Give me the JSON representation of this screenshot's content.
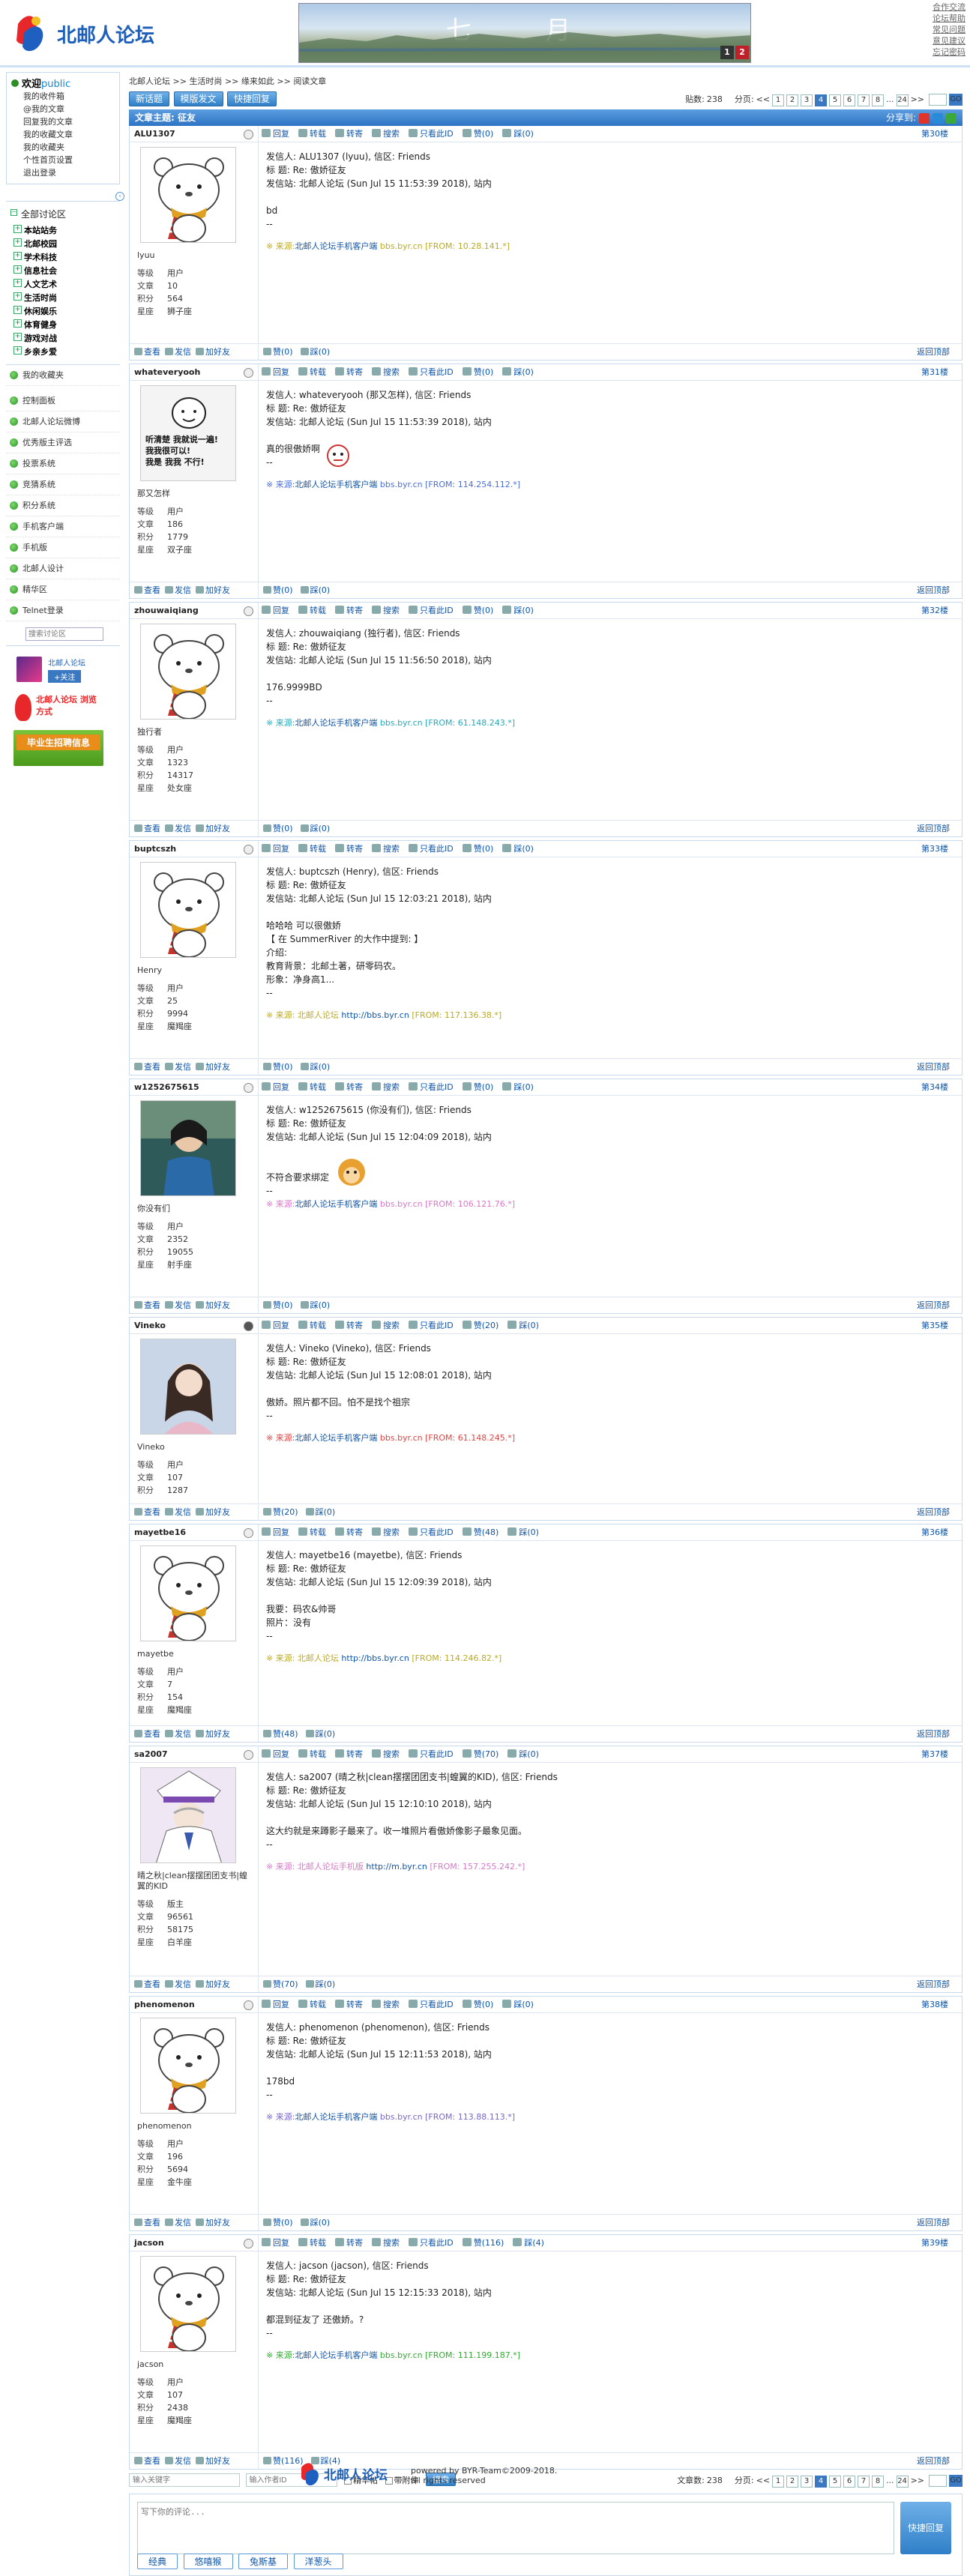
{
  "site": {
    "name": "北邮人论坛"
  },
  "toplinks": [
    "合作交流",
    "论坛帮助",
    "常见问题",
    "意见建议",
    "忘记密码"
  ],
  "banner": {
    "text": "七 月",
    "page_buttons": [
      "1",
      "2"
    ]
  },
  "welcome": {
    "hello": "欢迎",
    "user": "public",
    "links": [
      "我的收件箱",
      "@我的文章",
      "回复我的文章",
      "我的收藏文章",
      "我的收藏夹",
      "个性首页设置",
      "退出登录"
    ]
  },
  "sidebar": {
    "all_boards": "全部讨论区",
    "boards": [
      "本站站务",
      "北邮校园",
      "学术科技",
      "信息社会",
      "人文艺术",
      "生活时尚",
      "休闲娱乐",
      "体育健身",
      "游戏对战",
      "乡亲乡爱"
    ],
    "items": [
      "我的收藏夹",
      "控制面板",
      "北邮人论坛微博",
      "优秀版主评选",
      "投票系统",
      "竞猜系统",
      "积分系统",
      "手机客户端",
      "手机版",
      "北邮人设计",
      "精华区",
      "Telnet登录"
    ],
    "search_placeholder": "搜索讨论区",
    "promo": {
      "weibo_name": "北邮人论坛",
      "follow": "+关注",
      "client": "北邮人论坛 浏览方式",
      "grad": "毕业生招聘信息"
    }
  },
  "breadcrumb": [
    "北邮人论坛",
    ">>",
    "生活时尚",
    ">>",
    "缘来如此",
    ">>",
    "阅读文章"
  ],
  "actions": [
    "新话题",
    "模版发文",
    "快捷回复"
  ],
  "pager": {
    "label": "贴数:",
    "count": "238",
    "pages_label": "分页:",
    "prev": "<<",
    "pages": [
      "1",
      "2",
      "3",
      "4",
      "5",
      "6",
      "7",
      "8",
      "...",
      "24"
    ],
    "next": ">>",
    "current": "4",
    "go": "GO"
  },
  "thread": {
    "title": "文章主题: 征友",
    "share": "分享到:"
  },
  "labels": {
    "reply": "回复",
    "forward": "转载",
    "transfer": "转寄",
    "search": "搜索",
    "only_author": "只看此ID",
    "like": "赞",
    "dislike": "踩",
    "view": "查看",
    "send": "发信",
    "add_friend": "加好友",
    "back_top": "返回顶部",
    "level": "等级",
    "posts": "文章",
    "score": "积分",
    "star": "星座"
  },
  "posts": [
    {
      "floor": "第30楼",
      "id": "ALU1307",
      "nick": "lyuu",
      "level": "用户",
      "posts": "10",
      "score": "564",
      "star": "狮子座",
      "like": "0",
      "dislike": "0",
      "lines": [
        "发信人: ALU1307 (lyuu), 信区: Friends",
        "标  题: Re: 傲娇征友",
        "发信站: 北邮人论坛 (Sun Jul 15 11:53:39 2018), 站内",
        "",
        "bd",
        "--"
      ],
      "src_label": "※ 来源:",
      "src_link": "北邮人论坛手机客户端",
      "src_text": " bbs.byr.cn [FROM: 10.28.141.*]",
      "src_color": "#bbaa22",
      "online": false,
      "avatar": "bear"
    },
    {
      "floor": "第31楼",
      "id": "whateveryooh",
      "nick": "那又怎样",
      "level": "用户",
      "posts": "186",
      "score": "1779",
      "star": "双子座",
      "like": "0",
      "dislike": "0",
      "lines": [
        "发信人: whateveryooh (那又怎样), 信区: Friends",
        "标  题: Re: 傲娇征友",
        "发信站: 北邮人论坛 (Sun Jul 15 11:53:39 2018), 站内",
        "",
        "真的很傲娇啊",
        "--"
      ],
      "src_label": "※ 来源:",
      "src_link": "北邮人论坛手机客户端",
      "src_text": " bbs.byr.cn [FROM: 114.254.112.*]",
      "src_color": "#4a6ed8",
      "online": false,
      "avatar": "meme",
      "meme_text": [
        "听清楚  我就说一遍!",
        "我我很可以!",
        "我是  我我  不行!"
      ]
    },
    {
      "floor": "第32楼",
      "id": "zhouwaiqiang",
      "nick": "独行者",
      "level": "用户",
      "posts": "1323",
      "score": "14317",
      "star": "处女座",
      "like": "0",
      "dislike": "0",
      "lines": [
        "发信人: zhouwaiqiang (独行者), 信区: Friends",
        "标  题: Re: 傲娇征友",
        "发信站: 北邮人论坛 (Sun Jul 15 11:56:50 2018), 站内",
        "",
        "176.9999BD",
        "--"
      ],
      "src_label": "※ 来源:",
      "src_link": "北邮人论坛手机客户端",
      "src_text": " bbs.byr.cn [FROM: 61.148.243.*]",
      "src_color": "#22aabb",
      "online": false,
      "avatar": "bear"
    },
    {
      "floor": "第33楼",
      "id": "buptcszh",
      "nick": "Henry",
      "level": "用户",
      "posts": "25",
      "score": "9994",
      "star": "魔羯座",
      "like": "0",
      "dislike": "0",
      "lines": [
        "发信人: buptcszh (Henry), 信区: Friends",
        "标  题: Re: 傲娇征友",
        "发信站: 北邮人论坛 (Sun Jul 15 12:03:21 2018), 站内",
        "",
        "哈哈哈 可以很傲娇",
        "【 在 SummerRiver 的大作中提到: 】",
        "介绍:",
        "教育背景：北邮土著，研零码农。",
        "形象：净身高1...",
        "--"
      ],
      "src_label": "※ 来源: 北邮人论坛",
      "src_link": " http://bbs.byr.cn",
      "src_text": " [FROM: 117.136.38.*]",
      "src_color": "#bbaa22",
      "online": false,
      "avatar": "bear"
    },
    {
      "floor": "第34楼",
      "id": "w1252675615",
      "nick": "你没有们",
      "level": "用户",
      "posts": "2352",
      "score": "19055",
      "star": "射手座",
      "like": "0",
      "dislike": "0",
      "lines": [
        "发信人: w1252675615 (你没有们), 信区: Friends",
        "标  题: Re: 傲娇征友",
        "发信站: 北邮人论坛 (Sun Jul 15 12:04:09 2018), 站内",
        "",
        "",
        "不符合要求绑定",
        "--"
      ],
      "src_label": "※ 来源:",
      "src_link": "北邮人论坛手机客户端",
      "src_text": " bbs.byr.cn [FROM: 106.121.76.*]",
      "src_color": "#d877c8",
      "online": false,
      "avatar": "photo1"
    },
    {
      "floor": "第35楼",
      "id": "Vineko",
      "nick": "Vineko",
      "level": "用户",
      "posts": "107",
      "score": "1287",
      "star": "",
      "like": "20",
      "dislike": "0",
      "lines": [
        "发信人: Vineko (Vineko), 信区: Friends",
        "标  题: Re: 傲娇征友",
        "发信站: 北邮人论坛 (Sun Jul 15 12:08:01 2018), 站内",
        "",
        "傲娇。照片都不回。怕不是找个祖宗",
        "--"
      ],
      "src_label": "※ 来源:",
      "src_link": "北邮人论坛手机客户端",
      "src_text": " bbs.byr.cn [FROM: 61.148.245.*]",
      "src_color": "#e04444",
      "online": true,
      "avatar": "photo2"
    },
    {
      "floor": "第36楼",
      "id": "mayetbe16",
      "nick": "mayetbe",
      "level": "用户",
      "posts": "7",
      "score": "154",
      "star": "魔羯座",
      "like": "48",
      "dislike": "0",
      "lines": [
        "发信人: mayetbe16 (mayetbe), 信区: Friends",
        "标  题: Re: 傲娇征友",
        "发信站: 北邮人论坛 (Sun Jul 15 12:09:39 2018), 站内",
        "",
        "我要：码农&帅哥",
        "照片：没有",
        "--"
      ],
      "src_label": "※ 来源: 北邮人论坛",
      "src_link": " http://bbs.byr.cn",
      "src_text": " [FROM: 114.246.82.*]",
      "src_color": "#bbaa22",
      "online": false,
      "avatar": "bear"
    },
    {
      "floor": "第37楼",
      "id": "sa2007",
      "nick": "晴之秋|clean摆摆团团支书|蝗翼的KID",
      "level": "版主",
      "posts": "96561",
      "score": "58175",
      "star": "白羊座",
      "like": "70",
      "dislike": "0",
      "lines": [
        "发信人: sa2007 (晴之秋|clean摆摆团团支书|蝗翼的KID), 信区: Friends",
        "标  题: Re: 傲娇征友",
        "发信站: 北邮人论坛 (Sun Jul 15 12:10:10 2018), 站内",
        "",
        "这大约就是来蹲影子最来了。收一堆照片看傲娇像影子最象见面。",
        "--"
      ],
      "src_label": "※ 来源: 北邮人论坛手机版",
      "src_link": " http://m.byr.cn",
      "src_text": " [FROM: 157.255.242.*]",
      "src_color": "#d877c8",
      "online": false,
      "avatar": "photo3"
    },
    {
      "floor": "第38楼",
      "id": "phenomenon",
      "nick": "phenomenon",
      "level": "用户",
      "posts": "196",
      "score": "5694",
      "star": "金牛座",
      "like": "0",
      "dislike": "0",
      "lines": [
        "发信人: phenomenon (phenomenon), 信区: Friends",
        "标  题: Re: 傲娇征友",
        "发信站: 北邮人论坛 (Sun Jul 15 12:11:53 2018), 站内",
        "",
        "178bd",
        "--"
      ],
      "src_label": "※ 来源:",
      "src_link": "北邮人论坛手机客户端",
      "src_text": " bbs.byr.cn [FROM: 113.88.113.*]",
      "src_color": "#7766cc",
      "online": false,
      "avatar": "bear"
    },
    {
      "floor": "第39楼",
      "id": "jacson",
      "nick": "jacson",
      "level": "用户",
      "posts": "107",
      "score": "2438",
      "star": "魔羯座",
      "like": "116",
      "dislike": "4",
      "lines": [
        "发信人: jacson (jacson), 信区: Friends",
        "标  题: Re: 傲娇征友",
        "发信站: 北邮人论坛 (Sun Jul 15 12:15:33 2018), 站内",
        "",
        "都混到征友了 还傲娇。?",
        "--"
      ],
      "src_label": "※ 来源:",
      "src_link": "北邮人论坛手机客户端",
      "src_text": " bbs.byr.cn [FROM: 111.199.187.*]",
      "src_color": "#33aa33",
      "online": false,
      "avatar": "bear"
    }
  ],
  "bottom": {
    "kw_placeholder": "输入关键字",
    "author_placeholder": "输入作者ID",
    "digest": "精华帖",
    "attach": "带附件",
    "search": "搜索",
    "count_label": "文章数:",
    "count": "238"
  },
  "reply": {
    "placeholder": "写下你的评论...",
    "send": "快捷回复",
    "emotions": [
      "经典",
      "悠嘻猴",
      "兔斯基",
      "洋葱头"
    ]
  },
  "footer": {
    "powered": "powered by BYR-Team©2009-2018.",
    "rights": "all rights reserved"
  }
}
